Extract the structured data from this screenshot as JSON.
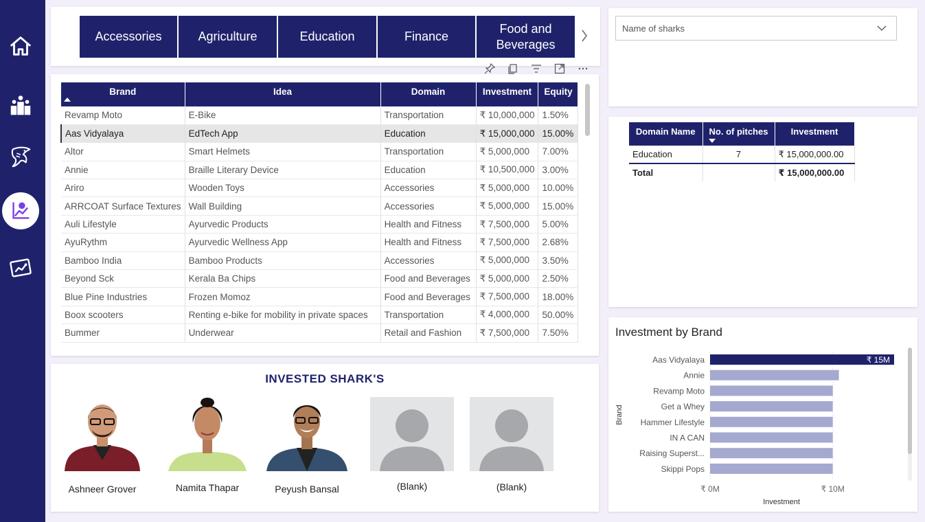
{
  "colors": {
    "navy": "#1f226b",
    "bar_light": "#a5a8cf",
    "accent_purple": "#7b3fe4"
  },
  "nav": [
    {
      "icon": "home-icon"
    },
    {
      "icon": "leaderboard-icon"
    },
    {
      "icon": "shark-icon"
    },
    {
      "icon": "analytics-icon",
      "active": true
    },
    {
      "icon": "trend-chart-icon"
    }
  ],
  "domain_slicer": {
    "tiles": [
      "Accessories",
      "Agriculture",
      "Education",
      "Finance",
      "Food and Beverages"
    ]
  },
  "main_table": {
    "columns": [
      "Brand",
      "Idea",
      "Domain",
      "Investment",
      "Equity"
    ],
    "rows": [
      [
        "Revamp Moto",
        "E-Bike",
        "Transportation",
        "₹ 10,000,000",
        "1.50%"
      ],
      [
        "Aas Vidyalaya",
        "EdTech App",
        "Education",
        "₹ 15,000,000",
        "15.00%"
      ],
      [
        "Altor",
        "Smart Helmets",
        "Transportation",
        "₹ 5,000,000",
        "7.00%"
      ],
      [
        "Annie",
        "Braille Literary Device",
        "Education",
        "₹ 10,500,000",
        "3.00%"
      ],
      [
        "Ariro",
        "Wooden Toys",
        "Accessories",
        "₹ 5,000,000",
        "10.00%"
      ],
      [
        "ARRCOAT Surface Textures",
        "Wall Building",
        "Accessories",
        "₹ 5,000,000",
        "15.00%"
      ],
      [
        "Auli Lifestyle",
        "Ayurvedic Products",
        "Health and Fitness",
        "₹ 7,500,000",
        "5.00%"
      ],
      [
        "AyuRythm",
        "Ayurvedic Wellness App",
        "Health and Fitness",
        "₹ 7,500,000",
        "2.68%"
      ],
      [
        "Bamboo India",
        "Bamboo Products",
        "Accessories",
        "₹ 5,000,000",
        "3.50%"
      ],
      [
        "Beyond Sck",
        "Kerala Ba Chips",
        "Food and Beverages",
        "₹ 5,000,000",
        "2.50%"
      ],
      [
        "Blue Pine Industries",
        "Frozen Momoz",
        "Food and Beverages",
        "₹ 7,500,000",
        "18.00%"
      ],
      [
        "Boox scooters",
        "Renting e-bike for mobility in private spaces",
        "Transportation",
        "₹ 4,000,000",
        "50.00%"
      ],
      [
        "Bummer",
        "Underwear",
        "Retail and Fashion",
        "₹ 7,500,000",
        "7.50%"
      ]
    ],
    "selected_row": 1
  },
  "sharks": {
    "title": "INVESTED SHARK'S",
    "items": [
      {
        "name": "Ashneer Grover"
      },
      {
        "name": "Namita Thapar"
      },
      {
        "name": "Peyush Bansal"
      },
      {
        "name": "(Blank)"
      },
      {
        "name": "(Blank)"
      }
    ]
  },
  "shark_filter": {
    "placeholder": "Name of sharks"
  },
  "domain_table": {
    "columns": [
      "Domain Name",
      "No. of pitches",
      "Investment"
    ],
    "rows": [
      [
        "Education",
        "7",
        "₹ 15,000,000.00"
      ]
    ],
    "total": [
      "Total",
      "",
      "₹ 15,000,000.00"
    ]
  },
  "chart_data": {
    "type": "bar",
    "orientation": "horizontal",
    "title": "Investment by Brand",
    "xlabel": "Investment",
    "ylabel": "Brand",
    "categories": [
      "Aas Vidyalaya",
      "Annie",
      "Revamp Moto",
      "Get a Whey",
      "Hammer Lifestyle",
      "IN A CAN",
      "Raising Superst...",
      "Skippi Pops"
    ],
    "values": [
      15000000,
      10500000,
      10000000,
      10000000,
      10000000,
      10000000,
      10000000,
      10000000
    ],
    "highlighted": "Aas Vidyalaya",
    "data_labels": {
      "Aas Vidyalaya": "₹ 15M"
    },
    "xticks": [
      "₹ 0M",
      "₹ 10M"
    ],
    "xlim": [
      0,
      15000000
    ],
    "grid": true
  }
}
